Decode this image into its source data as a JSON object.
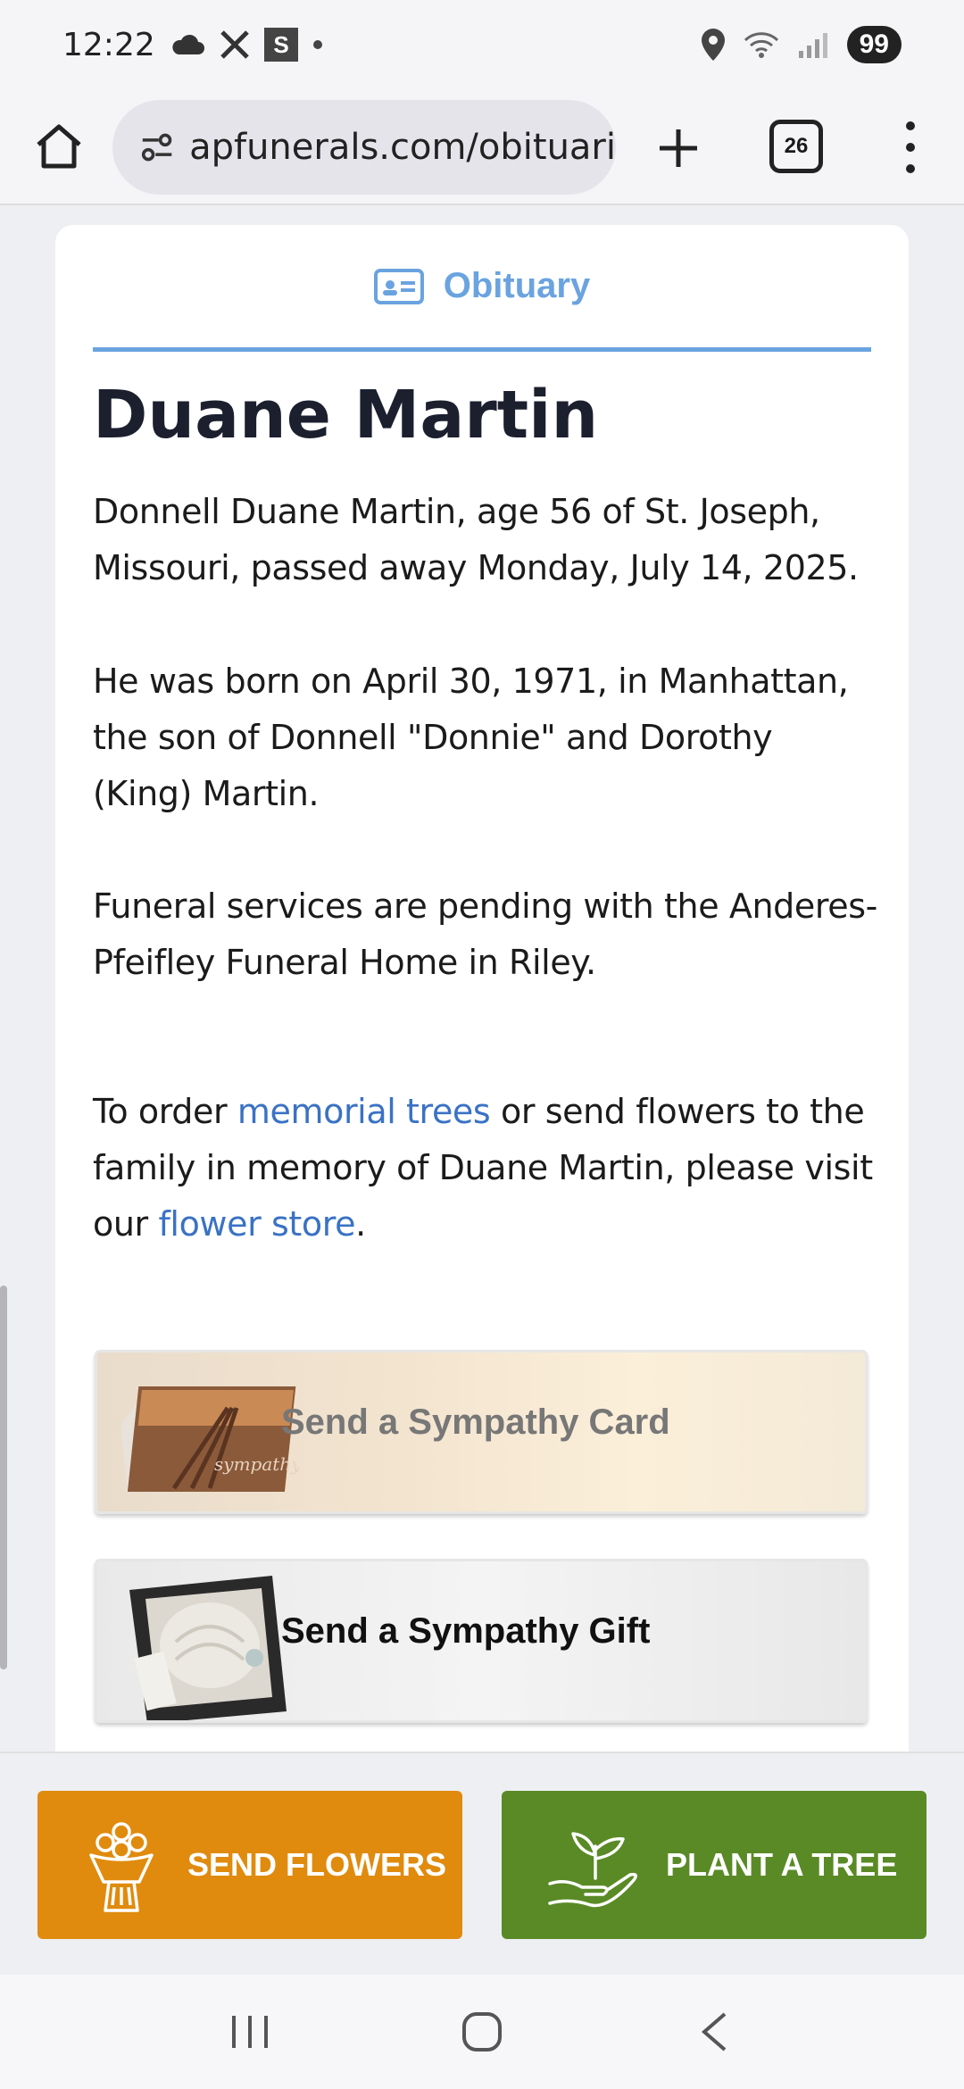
{
  "status": {
    "time": "12:22",
    "battery": "99",
    "icons": [
      "cloud-icon",
      "x-app-icon",
      "s-app-icon",
      "dot-icon",
      "location-icon",
      "wifi-icon",
      "signal-icon"
    ]
  },
  "browser": {
    "url": "apfunerals.com/obituari",
    "tab_count": "26",
    "icons": [
      "home-icon",
      "site-settings-icon",
      "plus-icon",
      "tabs-icon",
      "more-icon"
    ]
  },
  "obituary": {
    "section_title": "Obituary",
    "name": "Duane Martin",
    "paragraph1": "Donnell Duane Martin, age 56 of St. Joseph, Missouri, passed away Monday, July 14, 2025.",
    "paragraph2": "He was born on April 30, 1971, in Manhattan, the son of Donnell \"Donnie\" and Dorothy (King) Martin.",
    "paragraph3": "Funeral services are pending with the Anderes-Pfeifley Funeral Home in Riley.",
    "order_prefix": "To order ",
    "memorial_trees_link": "memorial trees",
    "order_middle": " or send flowers to the family in memory of Duane Martin, please visit our ",
    "flower_store_link": "flower store",
    "order_suffix": "."
  },
  "promos": {
    "card_label": "Send a Sympathy Card",
    "card_thumb_text": "sympathy",
    "gift_label": "Send a Sympathy Gift"
  },
  "actions": {
    "send_flowers": "SEND FLOWERS",
    "plant_tree": "PLANT A TREE"
  },
  "colors": {
    "accent_blue": "#6aa3e0",
    "link_blue": "#3a72c4",
    "flowers_orange": "#e08b0e",
    "tree_green": "#5a8a26"
  }
}
